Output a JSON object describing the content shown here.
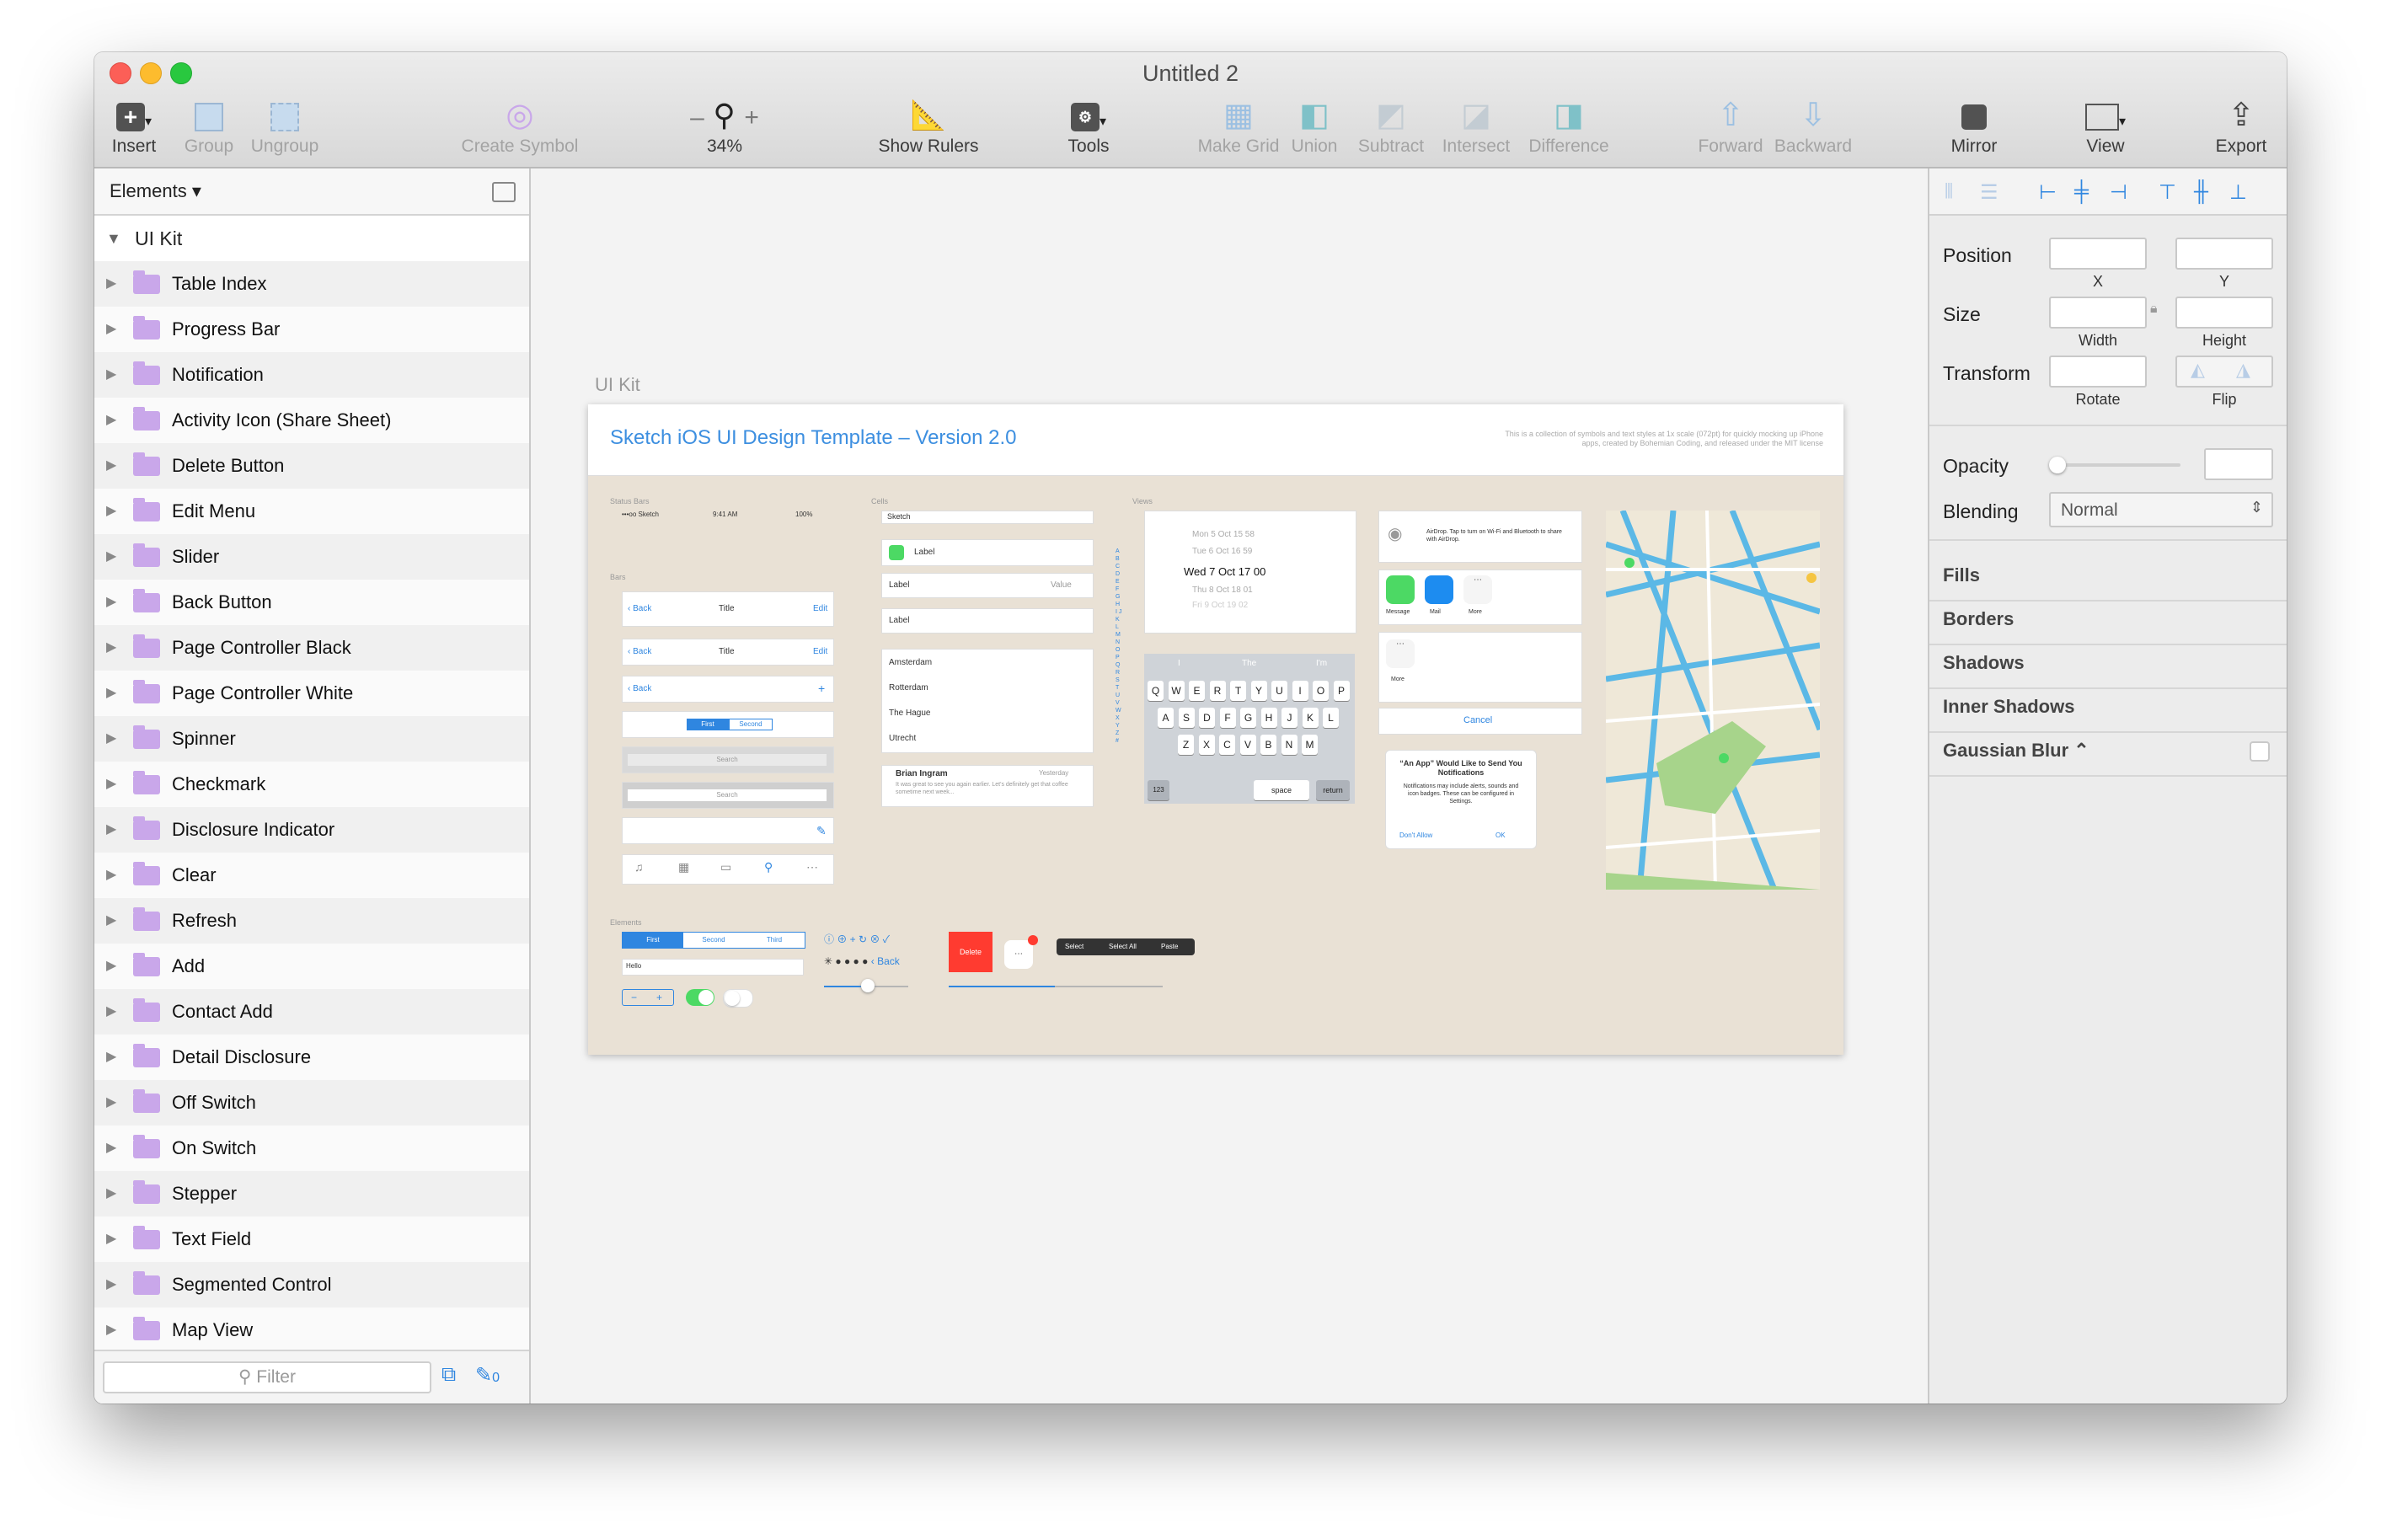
{
  "window": {
    "title": "Untitled 2"
  },
  "toolbar": {
    "insert": "Insert",
    "group": "Group",
    "ungroup": "Ungroup",
    "create_symbol": "Create Symbol",
    "zoom_level": "34%",
    "zoom_minus": "–",
    "zoom_plus": "+",
    "show_rulers": "Show Rulers",
    "tools": "Tools",
    "make_grid": "Make Grid",
    "union": "Union",
    "subtract": "Subtract",
    "intersect": "Intersect",
    "difference": "Difference",
    "forward": "Forward",
    "backward": "Backward",
    "mirror": "Mirror",
    "view": "View",
    "export": "Export"
  },
  "sidebar": {
    "header": "Elements ▾",
    "group": "UI Kit",
    "items": [
      "Table Index",
      "Progress Bar",
      "Notification",
      "Activity Icon (Share Sheet)",
      "Delete Button",
      "Edit Menu",
      "Slider",
      "Back Button",
      "Page Controller Black",
      "Page Controller White",
      "Spinner",
      "Checkmark",
      "Disclosure Indicator",
      "Clear",
      "Refresh",
      "Add",
      "Contact Add",
      "Detail Disclosure",
      "Off Switch",
      "On Switch",
      "Stepper",
      "Text Field",
      "Segmented Control",
      "Map View"
    ],
    "filter_placeholder": "Filter",
    "edit_count": "0"
  },
  "canvas": {
    "artboard_label": "UI Kit",
    "artboard_title": "Sketch iOS UI Design Template – Version 2.0",
    "artboard_desc": "This is a collection of symbols and text styles at 1x scale (072pt) for quickly mocking up iPhone apps, created by Bohemian Coding, and released under the MIT license",
    "sections": {
      "status_bars": "Status Bars",
      "bars": "Bars",
      "cells": "Cells",
      "views": "Views",
      "elements": "Elements"
    },
    "mock": {
      "status_carrier": "•••oo Sketch",
      "status_time": "9:41 AM",
      "status_battery": "100%",
      "back": "Back",
      "title": "Title",
      "edit": "Edit",
      "seg_first": "First",
      "seg_second": "Second",
      "seg_third": "Third",
      "search": "Search",
      "cell_sketch": "Sketch",
      "cell_label": "Label",
      "cell_value": "Value",
      "cities": [
        "Amsterdam",
        "Rotterdam",
        "The Hague",
        "Utrecht"
      ],
      "msg_name": "Brian Ingram",
      "msg_time": "Yesterday",
      "msg_body": "It was great to see you again earlier. Let's definitely get that coffee sometime next week...",
      "picker_rows": [
        "Mon 5 Oct   15   58",
        "Tue 6 Oct   16   59",
        "Wed 7 Oct   17   00",
        "Thu 8 Oct   18   01",
        "Fri 9 Oct   19   02"
      ],
      "kb_suggest": [
        "I",
        "The",
        "I'm"
      ],
      "kb_row1": [
        "Q",
        "W",
        "E",
        "R",
        "T",
        "Y",
        "U",
        "I",
        "O",
        "P"
      ],
      "kb_row2": [
        "A",
        "S",
        "D",
        "F",
        "G",
        "H",
        "J",
        "K",
        "L"
      ],
      "kb_row3": [
        "Z",
        "X",
        "C",
        "V",
        "B",
        "N",
        "M"
      ],
      "kb_123": "123",
      "kb_space": "space",
      "kb_return": "return",
      "airdrop": "AirDrop. Tap to turn on Wi-Fi and Bluetooth to share with AirDrop.",
      "share_message": "Message",
      "share_mail": "Mail",
      "share_more": "More",
      "cancel": "Cancel",
      "alert_title": "“An App” Would Like to Send You Notifications",
      "alert_body": "Notifications may include alerts, sounds and icon badges. These can be configured in Settings.",
      "alert_dont": "Don't Allow",
      "alert_ok": "OK",
      "text_field": "Hello",
      "delete": "Delete",
      "menu_select": "Select",
      "menu_select_all": "Select All",
      "menu_paste": "Paste"
    }
  },
  "inspector": {
    "position": "Position",
    "x": "X",
    "y": "Y",
    "size": "Size",
    "width": "Width",
    "height": "Height",
    "transform": "Transform",
    "rotate": "Rotate",
    "flip": "Flip",
    "opacity": "Opacity",
    "blending": "Blending",
    "blending_value": "Normal",
    "fills": "Fills",
    "borders": "Borders",
    "shadows": "Shadows",
    "inner_shadows": "Inner Shadows",
    "gaussian_blur": "Gaussian Blur ⌃"
  }
}
